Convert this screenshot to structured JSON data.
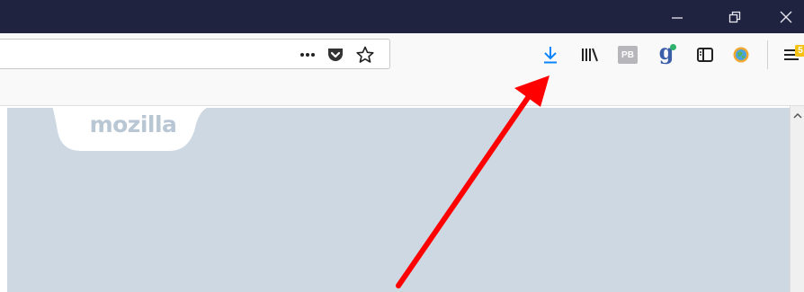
{
  "window": {
    "minimize_icon": "minimize-icon",
    "restore_icon": "restore-icon",
    "close_icon": "close-icon"
  },
  "urlbar": {
    "value": "",
    "page_actions_icon": "ellipsis-icon",
    "pocket_icon": "pocket-icon",
    "bookmark_icon": "star-icon"
  },
  "toolbar": {
    "download_icon": "download-icon",
    "library_icon": "library-icon",
    "pb_extension_label": "PB",
    "grammarly_label": "g",
    "sidebar_icon": "sidebar-icon",
    "extension_icon": "globe-extension-icon",
    "menu_icon": "hamburger-menu-icon",
    "menu_badge": "5"
  },
  "page": {
    "logo_text": "mozilla"
  },
  "annotation": {
    "arrow_color": "#ff0000"
  },
  "colors": {
    "titlebar": "#202340",
    "download_blue": "#0a84ff",
    "page_background": "#cdd8e3"
  }
}
